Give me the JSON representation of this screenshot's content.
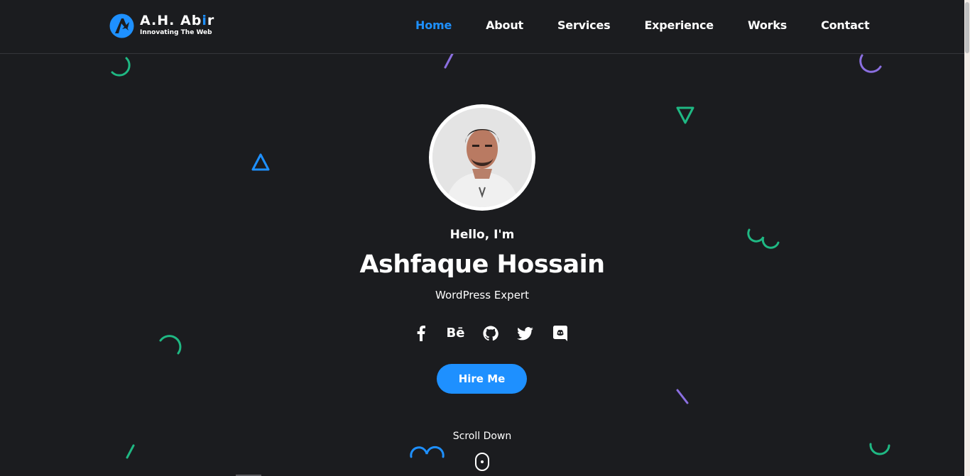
{
  "header": {
    "logo": {
      "title_main": "A.H. Ab",
      "title_accent": "i",
      "title_end": "r",
      "tagline": "Innovating The Web"
    },
    "nav": [
      {
        "label": "Home",
        "active": true
      },
      {
        "label": "About",
        "active": false
      },
      {
        "label": "Services",
        "active": false
      },
      {
        "label": "Experience",
        "active": false
      },
      {
        "label": "Works",
        "active": false
      },
      {
        "label": "Contact",
        "active": false
      }
    ]
  },
  "hero": {
    "greeting": "Hello, I'm",
    "name": "Ashfaque Hossain",
    "role": "WordPress Expert",
    "socials": [
      {
        "icon": "facebook-icon"
      },
      {
        "icon": "behance-icon",
        "text": "Bē"
      },
      {
        "icon": "github-icon"
      },
      {
        "icon": "twitter-icon"
      },
      {
        "icon": "discord-icon"
      }
    ],
    "hire_label": "Hire Me",
    "scroll_label": "Scroll Down"
  },
  "colors": {
    "background": "#1b1c1f",
    "accent": "#1e90ff",
    "shape_green": "#1fb883",
    "shape_purple": "#8b6fe0",
    "shape_blue": "#1e90ff"
  }
}
